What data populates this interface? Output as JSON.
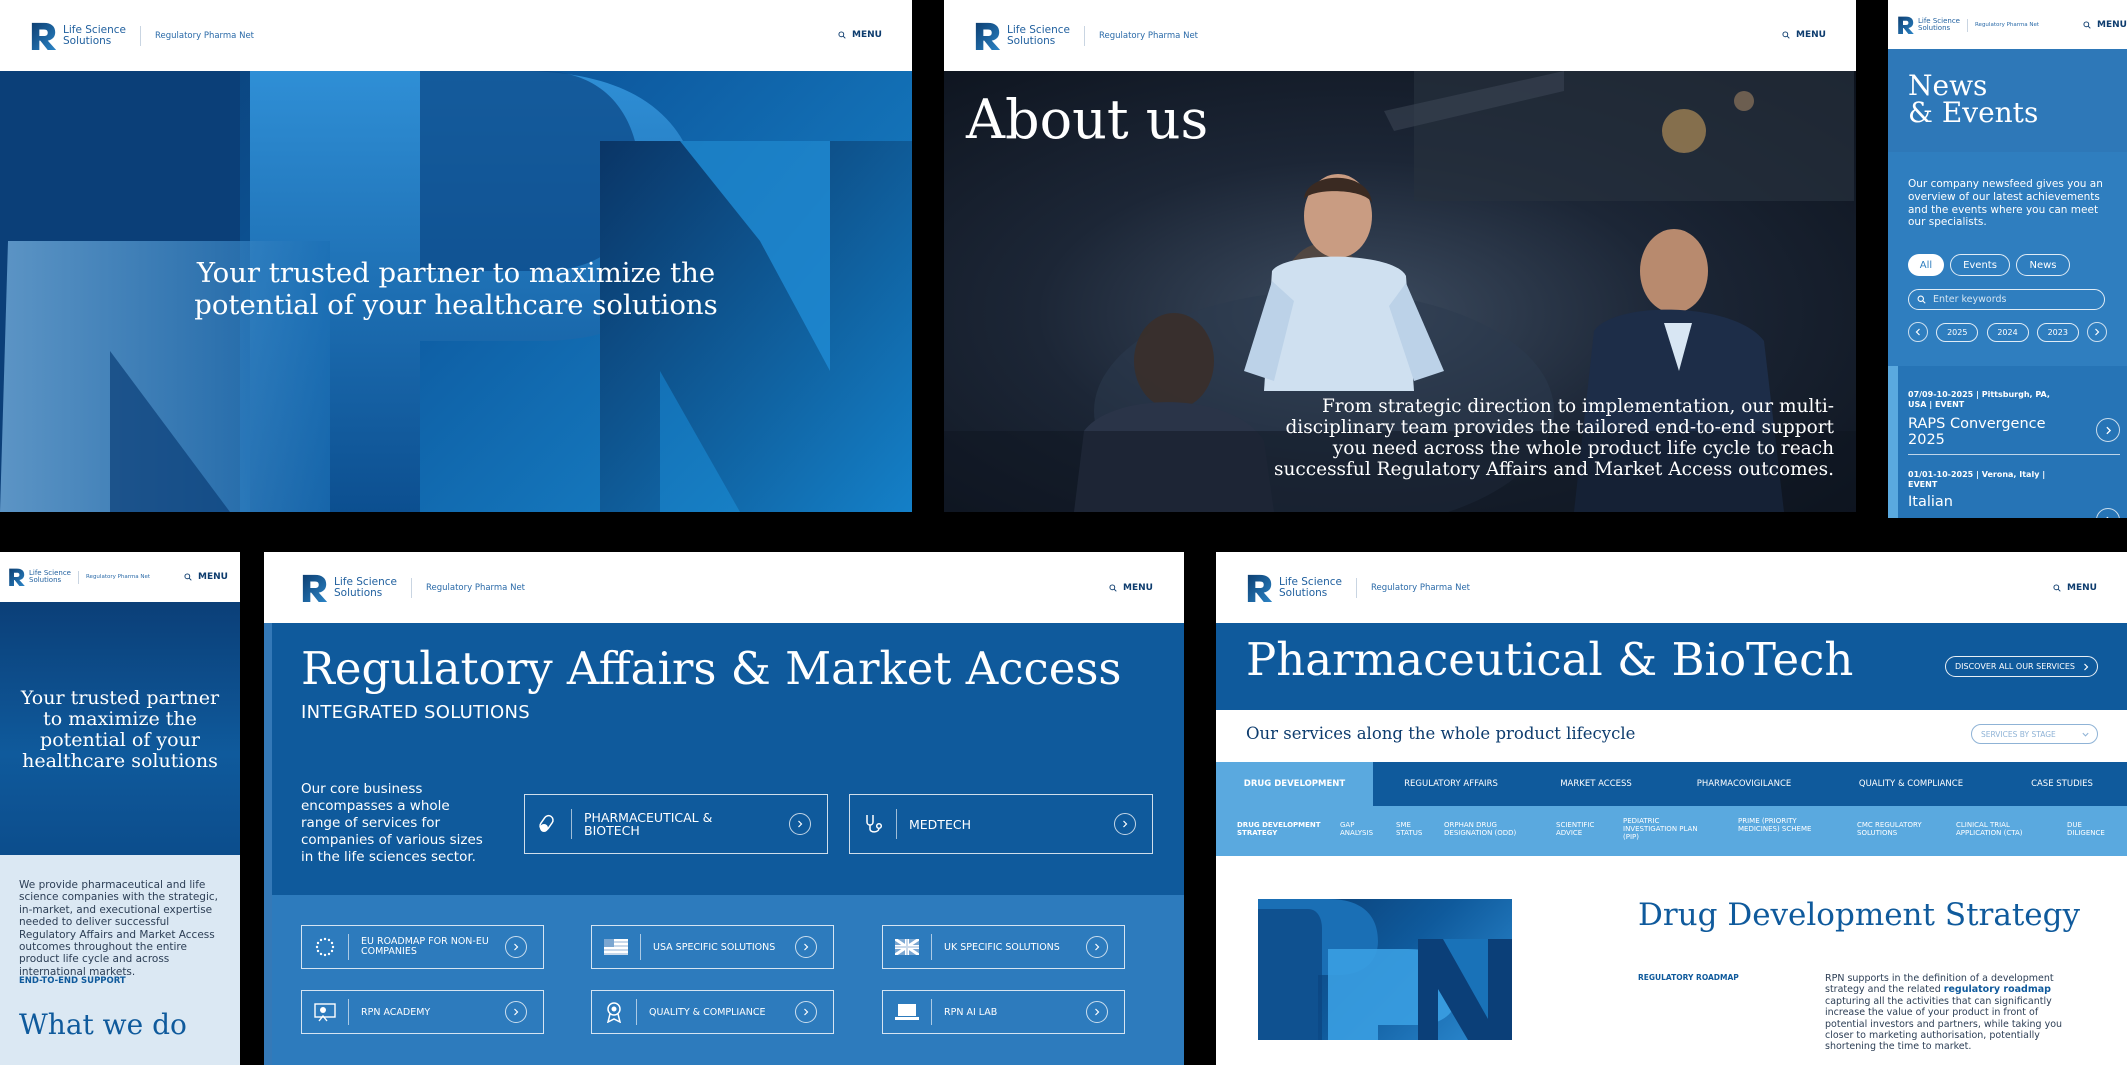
{
  "brand": {
    "line1": "Life Science",
    "line2": "Solutions",
    "sub": "Regulatory Pharma Net",
    "menu": "MENU"
  },
  "hero": {
    "headline": "Your trusted partner to maximize the potential of your healthcare solutions"
  },
  "about": {
    "title": "About us",
    "body": "From strategic direction to implementation, our multi-disciplinary team provides the tailored end-to-end support you need across the whole product life cycle to reach successful Regulatory Affairs and Market Access outcomes."
  },
  "news": {
    "title_line1": "News",
    "title_line2": "& Events",
    "intro": "Our company newsfeed gives you an overview of our latest achievements and the events where you can meet our specialists.",
    "filters": [
      "All",
      "Events",
      "News"
    ],
    "search_placeholder": "Enter keywords",
    "years": [
      "2025",
      "2024",
      "2023"
    ],
    "items": [
      {
        "meta": "07/09-10-2025 | Pittsburgh, PA, USA | EVENT",
        "title": "RAPS Convergence 2025"
      },
      {
        "meta": "01/01-10-2025 | Verona, Italy | EVENT",
        "title": "Italian"
      }
    ]
  },
  "mobile": {
    "headline": "Your trusted partner to maximize the potential of your healthcare solutions",
    "body": "We provide pharmaceutical and life science companies with the strategic, in-market, and executional expertise needed to deliver successful Regulatory Affairs and Market Access outcomes throughout the entire product life cycle and across international markets.",
    "link": "END-TO-END SUPPORT",
    "section_title": "What we do"
  },
  "ra": {
    "title": "Regulatory Affairs & Market Access",
    "subtitle": "INTEGRATED SOLUTIONS",
    "core": "Our core business encompasses a whole range of services for companies of various sizes in the life sciences sector.",
    "cards": [
      {
        "label": "PHARMACEUTICAL & BIOTECH",
        "icon": "pill-icon"
      },
      {
        "label": "MEDTECH",
        "icon": "stethoscope-icon"
      }
    ],
    "tiles": [
      {
        "label": "EU ROADMAP FOR NON-EU COMPANIES",
        "icon": "eu-flag-icon"
      },
      {
        "label": "USA SPECIFIC SOLUTIONS",
        "icon": "us-flag-icon"
      },
      {
        "label": "UK SPECIFIC SOLUTIONS",
        "icon": "uk-flag-icon"
      },
      {
        "label": "RPN ACADEMY",
        "icon": "academy-icon"
      },
      {
        "label": "QUALITY & COMPLIANCE",
        "icon": "award-icon"
      },
      {
        "label": "RPN AI LAB",
        "icon": "laptop-icon"
      }
    ]
  },
  "pharma": {
    "title": "Pharmaceutical & BioTech",
    "discover": "DISCOVER ALL OUR SERVICES",
    "lifecycle": "Our services along the whole product lifecycle",
    "stage_select": "SERVICES BY STAGE",
    "tabs": [
      "DRUG DEVELOPMENT",
      "REGULATORY AFFAIRS",
      "MARKET ACCESS",
      "PHARMACOVIGILANCE",
      "QUALITY & COMPLIANCE",
      "CASE STUDIES"
    ],
    "subtabs": [
      "DRUG DEVELOPMENT STRATEGY",
      "GAP ANALYSIS",
      "SME STATUS",
      "ORPHAN DRUG DESIGNATION (ODD)",
      "SCIENTIFIC ADVICE",
      "PEDIATRIC INVESTIGATION PLAN (PIP)",
      "PRIME (PRIORITY MEDICINES) SCHEME",
      "CMC REGULATORY SOLUTIONS",
      "CLINICAL TRIAL APPLICATION (CTA)",
      "DUE DILIGENCE"
    ],
    "section_title": "Drug Development Strategy",
    "roadmap_label": "REGULATORY ROADMAP",
    "body_before": "RPN supports in the definition of a development strategy and the related ",
    "body_bold": "regulatory roadmap",
    "body_after": " capturing all the activities that can significantly increase the value of your product in front of potential investors and partners, while taking you closer to marketing authorisation, potentially shortening the time to market."
  },
  "colors": {
    "navy": "#0d3c6e",
    "blue": "#0f5a9c",
    "light": "#3a8ac8",
    "accent": "#5aa9df"
  }
}
